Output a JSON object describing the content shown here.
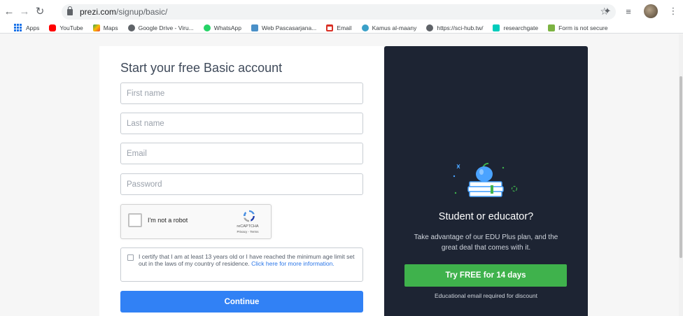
{
  "browser": {
    "url_host": "prezi.com",
    "url_path": "/signup/basic/",
    "bookmarks": [
      {
        "label": "Apps",
        "icon": "apps-icon",
        "color": "#1a73e8"
      },
      {
        "label": "YouTube",
        "icon": "youtube-icon",
        "color": "#ff0000"
      },
      {
        "label": "Maps",
        "icon": "maps-icon",
        "color": "#34a853"
      },
      {
        "label": "Google Drive - Viru...",
        "icon": "globe-icon",
        "color": "#5f6368"
      },
      {
        "label": "WhatsApp",
        "icon": "whatsapp-icon",
        "color": "#25d366"
      },
      {
        "label": "Web Pascasarjana...",
        "icon": "site-icon",
        "color": "#4a90c8"
      },
      {
        "label": "Email",
        "icon": "gmail-icon",
        "color": "#d93025"
      },
      {
        "label": "Kamus al-maany",
        "icon": "site-icon",
        "color": "#3aa0c8"
      },
      {
        "label": "https://sci-hub.tw/",
        "icon": "globe-icon",
        "color": "#5f6368"
      },
      {
        "label": "researchgate",
        "icon": "researchgate-icon",
        "color": "#00ccbb"
      },
      {
        "label": "Form is not secure",
        "icon": "site-icon",
        "color": "#7cb342"
      }
    ]
  },
  "signup": {
    "title": "Start your free Basic account",
    "first_name_placeholder": "First name",
    "last_name_placeholder": "Last name",
    "email_placeholder": "Email",
    "password_placeholder": "Password",
    "captcha_label": "I'm not a robot",
    "captcha_brand": "reCAPTCHA",
    "captcha_terms": "Privacy - Terms",
    "certify_text": "I certify that I am at least 13 years old or I have reached the minimum age limit set out in the laws of my country of residence.",
    "certify_link": "Click here for more information.",
    "continue_label": "Continue"
  },
  "edu": {
    "title": "Student or educator?",
    "description": "Take advantage of our EDU Plus plan, and the great deal that comes with it.",
    "cta_label": "Try FREE for 14 days",
    "note": "Educational email required for discount"
  },
  "colors": {
    "primary_blue": "#3181f5",
    "green": "#3fb24c",
    "dark_panel": "#1d2433"
  }
}
